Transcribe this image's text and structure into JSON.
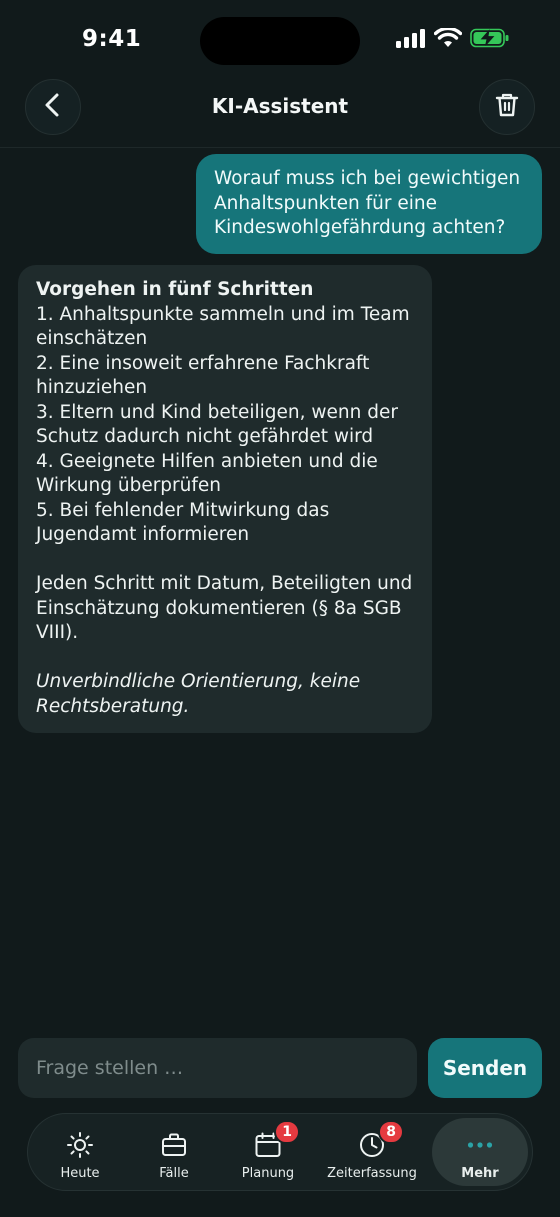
{
  "status_bar": {
    "time": "9:41"
  },
  "header": {
    "title": "KI-Assistent",
    "back_icon": "chevron-left-icon",
    "delete_icon": "trash-icon"
  },
  "chat": {
    "user_message": "Worauf muss ich bei gewichtigen Anhaltspunkten für eine Kindeswohlgefährdung achten?",
    "assistant": {
      "heading": "Vorgehen in fünf Schritten",
      "steps": [
        "1. Anhaltspunkte sammeln und im Team einschätzen",
        "2. Eine insoweit erfahrene Fachkraft hinzuziehen",
        "3. Eltern und Kind beteiligen, wenn der Schutz dadurch nicht gefährdet wird",
        "4. Geeignete Hilfen anbieten und die Wirkung überprüfen",
        "5. Bei fehlender Mitwirkung das Jugendamt informieren"
      ],
      "documentation_note": "Jeden Schritt mit Datum, Beteiligten und Einschätzung dokumentieren (§ 8a SGB VIII).",
      "disclaimer": "Unverbindliche Orientierung, keine Rechtsberatung."
    }
  },
  "composer": {
    "placeholder": "Frage stellen …",
    "value": "",
    "send_label": "Senden"
  },
  "tabbar": {
    "items": [
      {
        "label": "Heute",
        "icon": "sun-icon",
        "badge": "",
        "active": false
      },
      {
        "label": "Fälle",
        "icon": "briefcase-icon",
        "badge": "",
        "active": false
      },
      {
        "label": "Planung",
        "icon": "calendar-icon",
        "badge": "1",
        "active": false
      },
      {
        "label": "Zeiterfassung",
        "icon": "clock-icon",
        "badge": "8",
        "active": false
      },
      {
        "label": "Mehr",
        "icon": "more-dots-icon",
        "badge": "",
        "active": true
      }
    ]
  },
  "colors": {
    "background": "#111a1b",
    "accent": "#16757a",
    "bubble": "#1f2b2c",
    "badge": "#e53a40",
    "battery_fill": "#35c759"
  }
}
